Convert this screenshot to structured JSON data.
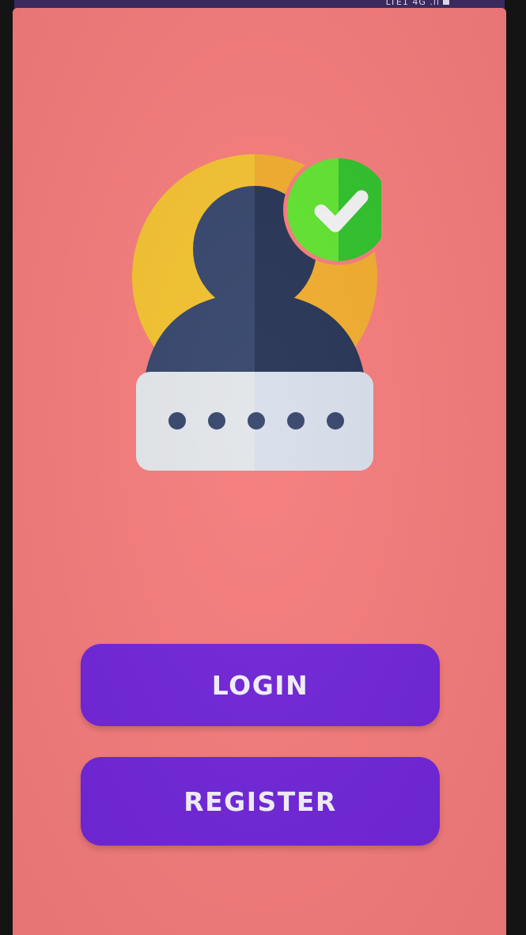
{
  "status_bar": {
    "indicators": "LTE1 4G .ıl"
  },
  "logo": {
    "icon": "user-verified-password-icon",
    "password_dot_count": 5,
    "colors": {
      "ring": "#f2c12e",
      "person": "#2c3a5c",
      "check_badge": "#46d62c",
      "password_box": "#dfe3ea"
    }
  },
  "actions": {
    "login_label": "LOGIN",
    "register_label": "REGISTER"
  },
  "theme": {
    "background": "#f57b7b",
    "button": "#6f24d8",
    "button_text": "#f4f1fb"
  }
}
